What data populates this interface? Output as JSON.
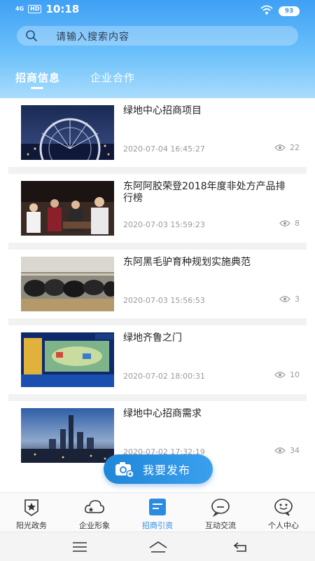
{
  "status_bar": {
    "network": "4G",
    "hd": "HD",
    "time": "10:18",
    "battery": "93"
  },
  "search": {
    "placeholder": "请输入搜索内容"
  },
  "tabs": [
    {
      "label": "招商信息",
      "active": true
    },
    {
      "label": "企业合作",
      "active": false
    }
  ],
  "articles": [
    {
      "title": "绿地中心招商项目",
      "date": "2020-07-04 16:45:27",
      "views": "22",
      "thumb_icon": "ferris-wheel-night-image"
    },
    {
      "title": "东阿阿胶荣登2018年度非处方产品排行榜",
      "date": "2020-07-03 15:59:23",
      "views": "8",
      "thumb_icon": "people-event-image"
    },
    {
      "title": "东阿黑毛驴育种规划实施典范",
      "date": "2020-07-03 15:56:53",
      "views": "3",
      "thumb_icon": "donkey-farm-image"
    },
    {
      "title": "绿地齐鲁之门",
      "date": "2020-07-02 18:00:31",
      "views": "10",
      "thumb_icon": "stage-presentation-image"
    },
    {
      "title": "绿地中心招商需求",
      "date": "2020-07-02 17:32:19",
      "views": "34",
      "thumb_icon": "city-skyline-image"
    }
  ],
  "publish_button": {
    "label": "我要发布",
    "icon": "camera-icon"
  },
  "bottom_nav": [
    {
      "label": "阳光政务",
      "icon": "star-badge-icon",
      "active": false
    },
    {
      "label": "企业形象",
      "icon": "cloud-star-icon",
      "active": false
    },
    {
      "label": "招商引资",
      "icon": "document-icon",
      "active": true
    },
    {
      "label": "互动交流",
      "icon": "chat-bubble-icon",
      "active": false
    },
    {
      "label": "个人中心",
      "icon": "smile-bubble-icon",
      "active": false
    }
  ],
  "system_nav": {
    "menu_icon": "menu-icon",
    "home_icon": "home-icon",
    "back_icon": "back-icon"
  },
  "colors": {
    "accent": "#2a8be0",
    "header_top": "#3fa0f5",
    "header_bottom": "#a9dcfd",
    "separator": "#f2f2f2"
  }
}
